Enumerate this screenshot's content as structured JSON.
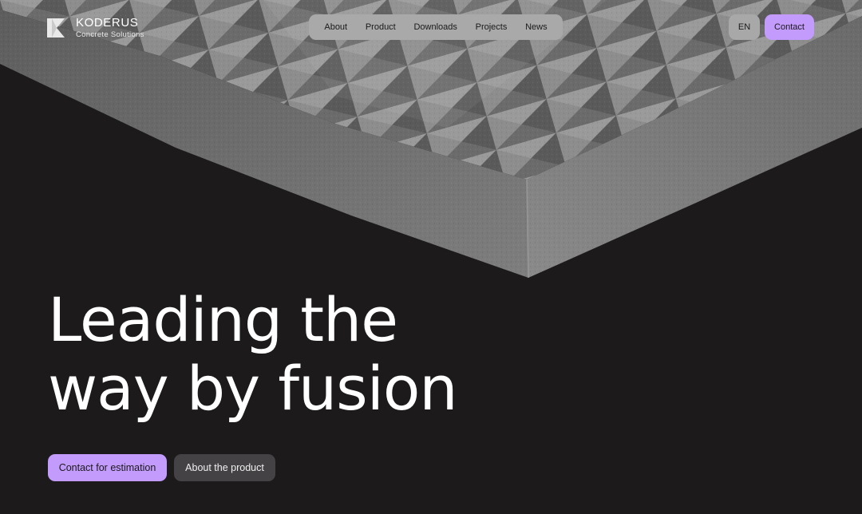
{
  "brand": {
    "name": "KODERUS",
    "tagline": "Concrete Solutions"
  },
  "nav": {
    "items": [
      {
        "label": "About"
      },
      {
        "label": "Product"
      },
      {
        "label": "Downloads"
      },
      {
        "label": "Projects"
      },
      {
        "label": "News"
      }
    ]
  },
  "header": {
    "language": "EN",
    "contact_label": "Contact"
  },
  "hero": {
    "headline_line1": "Leading the",
    "headline_line2": "way by fusion",
    "cta_primary": "Contact for estimation",
    "cta_secondary": "About the product",
    "image": "concrete-panel-with-pyramid-relief"
  },
  "colors": {
    "background": "#1c1a1b",
    "accent": "#c29bfd",
    "nav_pill": "#a9a9a9",
    "secondary_button": "#444244"
  }
}
